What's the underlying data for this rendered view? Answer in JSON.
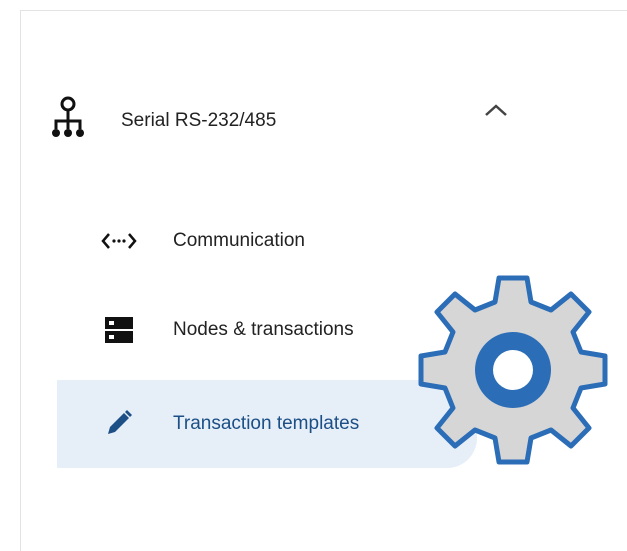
{
  "group": {
    "label": "Serial RS-232/485",
    "icon": "network-tree-icon",
    "expanded": true
  },
  "nav": [
    {
      "label": "Communication",
      "icon": "code-dots-icon",
      "selected": false
    },
    {
      "label": "Nodes & transactions",
      "icon": "server-icon",
      "selected": false
    },
    {
      "label": "Transaction templates",
      "icon": "pencil-icon",
      "selected": true
    }
  ],
  "colors": {
    "selected_bg": "#e6eef8",
    "selected_text": "#1b4f86",
    "gear_fill": "#d6d6d6",
    "gear_outline": "#2c6db7",
    "gear_center": "#2c6db7"
  },
  "overlay": {
    "icon": "gear-icon"
  }
}
